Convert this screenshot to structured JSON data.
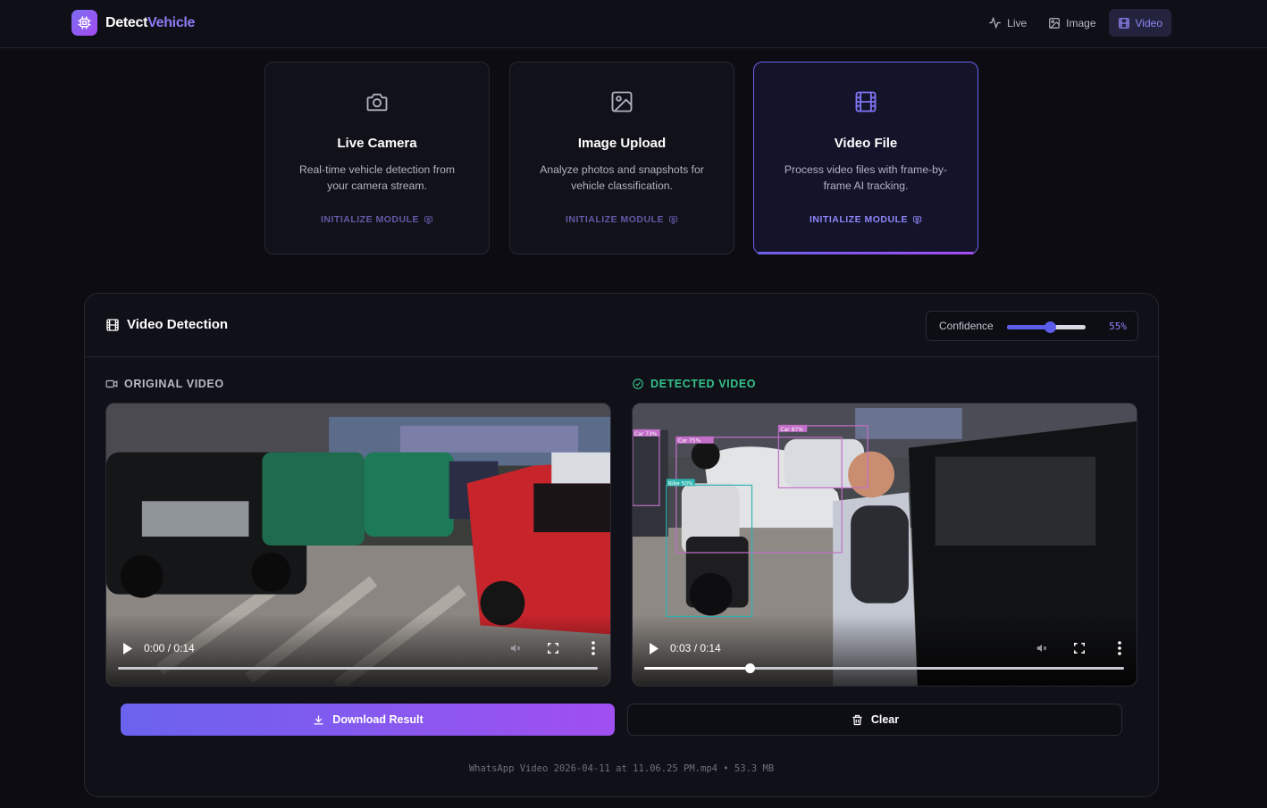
{
  "app": {
    "brand_part1": "Detect",
    "brand_part2": "Vehicle"
  },
  "nav": [
    {
      "label": "Live",
      "icon": "activity-icon",
      "active": false
    },
    {
      "label": "Image",
      "icon": "image-icon",
      "active": false
    },
    {
      "label": "Video",
      "icon": "film-icon",
      "active": true
    }
  ],
  "modules": [
    {
      "title": "Live Camera",
      "desc": "Real-time vehicle detection from your camera stream.",
      "link": "INITIALIZE MODULE",
      "icon": "camera-icon"
    },
    {
      "title": "Image Upload",
      "desc": "Analyze photos and snapshots for vehicle classification.",
      "link": "INITIALIZE MODULE",
      "icon": "image-icon"
    },
    {
      "title": "Video File",
      "desc": "Process video files with frame-by-frame AI tracking.",
      "link": "INITIALIZE MODULE",
      "icon": "film-icon",
      "active": true
    }
  ],
  "panel": {
    "title": "Video Detection",
    "confidence_label": "Confidence",
    "confidence_value": "55%",
    "confidence_fraction": 0.55,
    "original_label": "ORIGINAL VIDEO",
    "detected_label": "DETECTED VIDEO",
    "original_time": "0:00 / 0:14",
    "original_progress": 0.0,
    "detected_time": "0:03 / 0:14",
    "detected_progress": 0.22,
    "detections": [
      {
        "label": "Car 73%"
      },
      {
        "label": "Car 75%"
      },
      {
        "label": "Car 87%"
      },
      {
        "label": "Bike 50%"
      }
    ],
    "download_label": "Download Result",
    "clear_label": "Clear",
    "file_info": "WhatsApp Video 2026-04-11 at 11.06.25 PM.mp4 • 53.3 MB"
  },
  "colors": {
    "accent": "#6e62ea",
    "accent2": "#a24cf0",
    "success": "#34c38a",
    "bg": "#0c0c12"
  }
}
